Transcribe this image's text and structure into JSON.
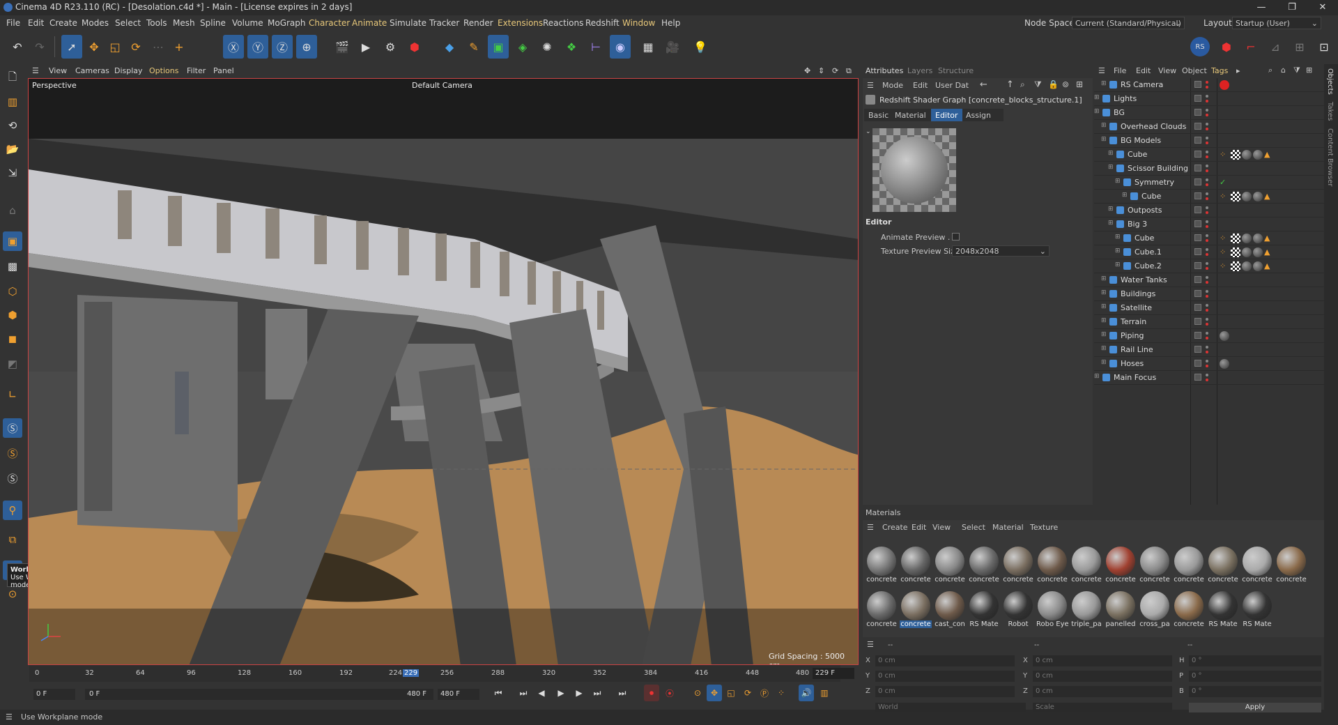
{
  "window": {
    "title": "Cinema 4D R23.110 (RC) - [Desolation.c4d *] - Main - [License expires in 2 days]",
    "controls": [
      "—",
      "❐",
      "✕"
    ]
  },
  "menubar": {
    "items": [
      "File",
      "Edit",
      "Create",
      "Modes",
      "Select",
      "Tools",
      "Mesh",
      "Spline",
      "Volume",
      "MoGraph",
      "Character",
      "Animate",
      "Simulate",
      "Tracker",
      "Render",
      "Extensions",
      "Reactions",
      "Redshift",
      "Window",
      "Help"
    ],
    "node_space_label": "Node Space:",
    "node_space_value": "Current (Standard/Physical)",
    "layout_label": "Layout:",
    "layout_value": "Startup (User)"
  },
  "viewport": {
    "menu": [
      "View",
      "Cameras",
      "Display",
      "Options",
      "Filter",
      "Panel"
    ],
    "view_name": "Perspective",
    "camera": "Default Camera",
    "grid_spacing": "Grid Spacing : 5000 cm"
  },
  "tooltip": {
    "title": "Workplane",
    "text": "Use Workplane mode"
  },
  "timeline": {
    "ticks": [
      "0",
      "32",
      "64",
      "96",
      "128",
      "160",
      "192",
      "224",
      "229",
      "256",
      "288",
      "320",
      "352",
      "384",
      "416",
      "448",
      "480"
    ],
    "current_frame": "229 F",
    "start": "0 F",
    "range_start": "0 F",
    "range_end": "480 F",
    "end": "480 F"
  },
  "status": "Use Workplane mode",
  "attributes": {
    "tabs": [
      "Attributes",
      "Layers",
      "Structure"
    ],
    "menu": [
      "Mode",
      "Edit",
      "User Dat"
    ],
    "object": "Redshift Shader Graph [concrete_blocks_structure.1]",
    "subtabs": [
      "Basic",
      "Material",
      "Editor",
      "Assign"
    ],
    "active_subtab": "Editor",
    "section": "Editor",
    "animate_preview_label": "Animate Preview . .",
    "texture_preview_label": "Texture Preview Size",
    "texture_preview_value": "2048x2048"
  },
  "objects": {
    "menu": [
      "File",
      "Edit",
      "View",
      "Object",
      "Tags"
    ],
    "side_tabs": [
      "Objects",
      "Takes",
      "Content Browser"
    ],
    "rows": [
      {
        "name": "RS Camera",
        "indent": 1,
        "tags": [
          "rs"
        ]
      },
      {
        "name": "Lights",
        "indent": 0,
        "tags": []
      },
      {
        "name": "BG",
        "indent": 0,
        "tags": []
      },
      {
        "name": "Overhead Clouds",
        "indent": 1,
        "tags": []
      },
      {
        "name": "BG Models",
        "indent": 1,
        "tags": []
      },
      {
        "name": "Cube",
        "indent": 2,
        "tags": [
          "mat",
          "chk",
          "ball",
          "ball",
          "tri"
        ]
      },
      {
        "name": "Scissor Building",
        "indent": 2,
        "tags": []
      },
      {
        "name": "Symmetry",
        "indent": 3,
        "tags": [
          "check"
        ]
      },
      {
        "name": "Cube",
        "indent": 4,
        "tags": [
          "mat",
          "chk",
          "ball",
          "ball",
          "tri"
        ]
      },
      {
        "name": "Outposts",
        "indent": 2,
        "tags": []
      },
      {
        "name": "Big 3",
        "indent": 2,
        "tags": []
      },
      {
        "name": "Cube",
        "indent": 3,
        "tags": [
          "mat",
          "chk",
          "ball",
          "ball",
          "tri"
        ]
      },
      {
        "name": "Cube.1",
        "indent": 3,
        "tags": [
          "mat",
          "chk",
          "ball",
          "ball",
          "tri"
        ]
      },
      {
        "name": "Cube.2",
        "indent": 3,
        "tags": [
          "mat",
          "chk",
          "ball",
          "ball",
          "tri"
        ]
      },
      {
        "name": "Water Tanks",
        "indent": 1,
        "tags": []
      },
      {
        "name": "Buildings",
        "indent": 1,
        "tags": []
      },
      {
        "name": "Satellite",
        "indent": 1,
        "tags": []
      },
      {
        "name": "Terrain",
        "indent": 1,
        "tags": []
      },
      {
        "name": "Piping",
        "indent": 1,
        "tags": [
          "ball"
        ]
      },
      {
        "name": "Rail Line",
        "indent": 1,
        "tags": []
      },
      {
        "name": "Hoses",
        "indent": 1,
        "tags": [
          "ball"
        ]
      },
      {
        "name": "Main Focus",
        "indent": 0,
        "tags": []
      }
    ]
  },
  "materials": {
    "title": "Materials",
    "menu": [
      "Create",
      "Edit",
      "View",
      "Select",
      "Material",
      "Texture"
    ],
    "row1": [
      "concrete",
      "concrete",
      "concrete",
      "concrete",
      "concrete",
      "concrete",
      "concrete",
      "concrete",
      "concrete",
      "concrete",
      "concrete",
      "concrete",
      "concrete"
    ],
    "row2": [
      "concrete",
      "concrete",
      "cast_con",
      "RS Mate",
      "Robot",
      "Robo Eye",
      "triple_pa",
      "panelled",
      "cross_pa",
      "concrete",
      "RS Mate",
      "RS Mate"
    ],
    "selected_index": 1
  },
  "coords": {
    "x": "0 cm",
    "y": "0 cm",
    "z": "0 cm",
    "sx": "0 cm",
    "sy": "0 cm",
    "sz": "0 cm",
    "h": "0 °",
    "p": "0 °",
    "b": "0 °",
    "dash": "--",
    "world": "World",
    "scale": "Scale",
    "apply": "Apply"
  },
  "colors": {
    "accent": "#2e5f99",
    "highlight_menu": "#e8c87a",
    "viewport_border": "#cc4444"
  }
}
